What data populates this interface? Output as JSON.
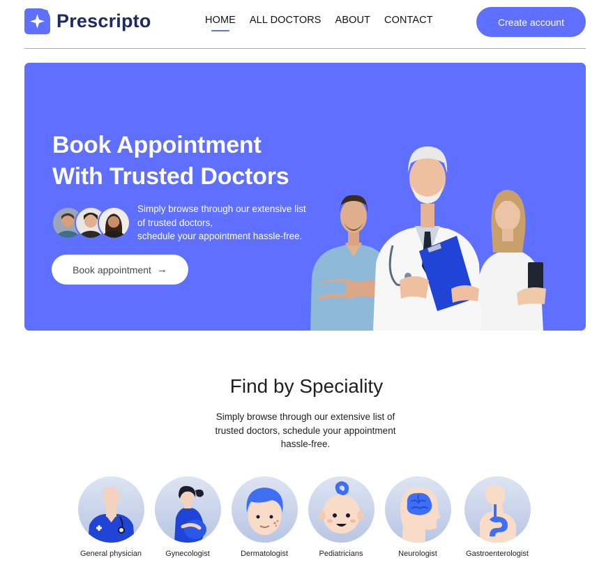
{
  "brand": {
    "name": "Prescripto",
    "accent": "#5f6fff",
    "dark": "#1d2a63"
  },
  "nav": {
    "items": [
      {
        "label": "HOME",
        "active": true
      },
      {
        "label": "ALL DOCTORS",
        "active": false
      },
      {
        "label": "ABOUT",
        "active": false
      },
      {
        "label": "CONTACT",
        "active": false
      }
    ],
    "create_account": "Create account"
  },
  "hero": {
    "title_line1": "Book Appointment",
    "title_line2": "With Trusted Doctors",
    "desc_line1": "Simply browse through our extensive list",
    "desc_line2": "of trusted doctors,",
    "desc_line3": "schedule your appointment hassle-free.",
    "button": "Book appointment",
    "button_icon": "arrow-right-icon"
  },
  "speciality": {
    "title": "Find by Speciality",
    "desc_line1": "Simply browse through our extensive list of",
    "desc_line2": "trusted doctors, schedule your appointment",
    "desc_line3": "hassle-free.",
    "items": [
      {
        "label": "General physician",
        "icon": "general-physician-icon"
      },
      {
        "label": "Gynecologist",
        "icon": "gynecologist-icon"
      },
      {
        "label": "Dermatologist",
        "icon": "dermatologist-icon"
      },
      {
        "label": "Pediatricians",
        "icon": "pediatrician-icon"
      },
      {
        "label": "Neurologist",
        "icon": "neurologist-icon"
      },
      {
        "label": "Gastroenterologist",
        "icon": "gastroenterologist-icon"
      }
    ]
  }
}
